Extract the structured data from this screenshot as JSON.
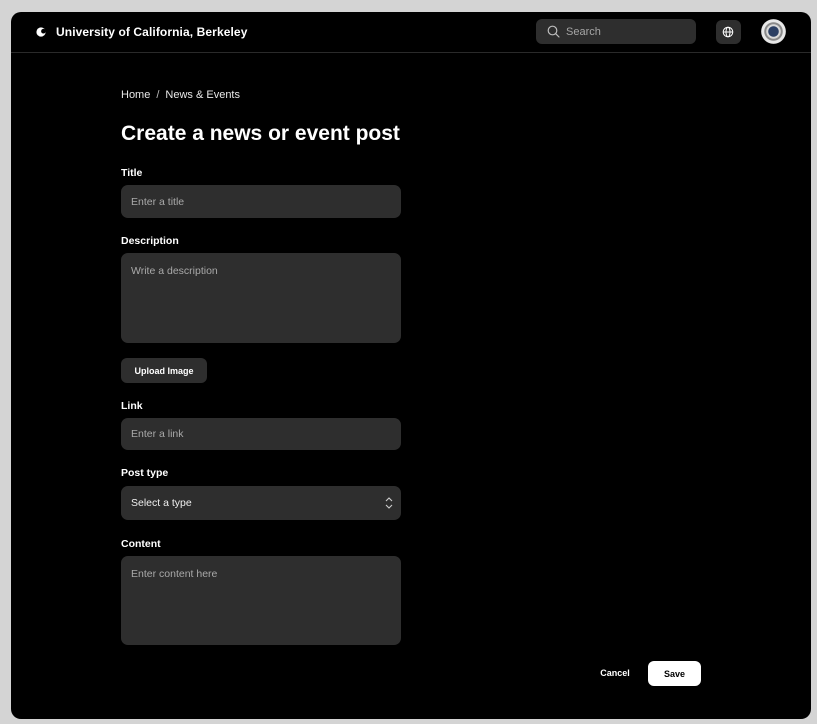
{
  "header": {
    "brand": "University of California, Berkeley",
    "logo_icon": "crescent-logo-icon",
    "search_placeholder": "Search",
    "language_icon": "globe-icon",
    "avatar_icon": "user-avatar"
  },
  "breadcrumb": {
    "home": "Home",
    "separator": "/",
    "current": "News & Events"
  },
  "page": {
    "title": "Create a news or event post"
  },
  "form": {
    "title_label": "Title",
    "title_placeholder": "Enter a title",
    "description_label": "Description",
    "description_placeholder": "Write a description",
    "upload_label": "Upload Image",
    "link_label": "Link",
    "link_placeholder": "Enter a link",
    "post_type_label": "Post type",
    "post_type_value": "Select a type",
    "content_label": "Content",
    "content_placeholder": "Enter content here"
  },
  "actions": {
    "cancel_label": "Cancel",
    "save_label": "Save"
  },
  "colors": {
    "background": "#000000",
    "field": "#2e2e2e",
    "text": "#ffffff",
    "frame": "#d4d4d4"
  }
}
